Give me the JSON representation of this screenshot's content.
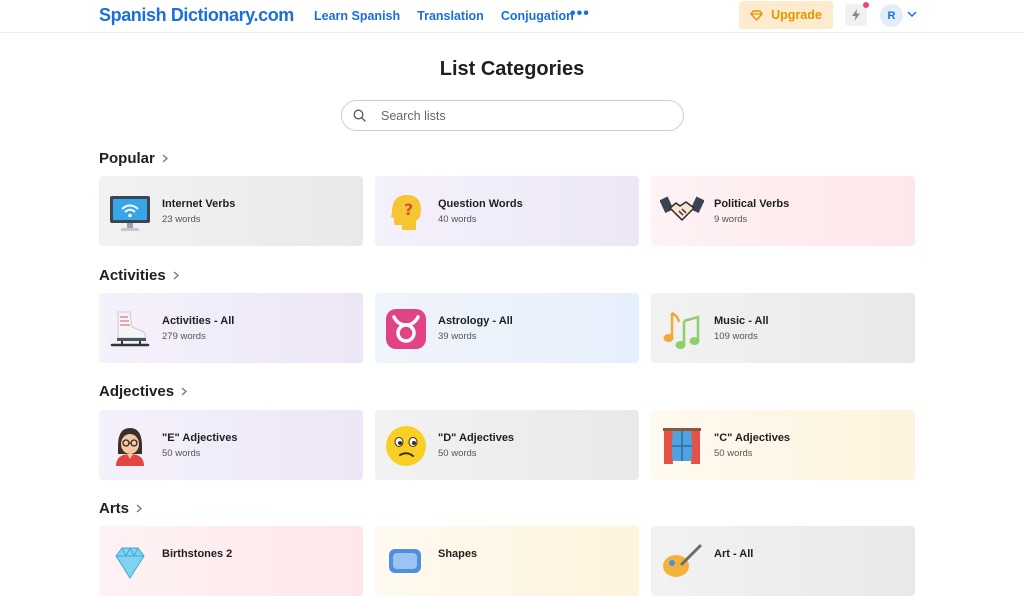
{
  "header": {
    "logo": "Spanish Dictionary.com",
    "nav": [
      "Learn Spanish",
      "Translation",
      "Conjugation"
    ],
    "more": "•••",
    "upgrade": "Upgrade",
    "avatar_initial": "R"
  },
  "page": {
    "title": "List Categories",
    "search_placeholder": "Search lists"
  },
  "sections": [
    {
      "title": "Popular",
      "cards": [
        {
          "name": "Internet Verbs",
          "count": "23 words",
          "icon": "computer-wifi-icon"
        },
        {
          "name": "Question Words",
          "count": "40 words",
          "icon": "question-head-icon"
        },
        {
          "name": "Political Verbs",
          "count": "9 words",
          "icon": "handshake-icon"
        }
      ]
    },
    {
      "title": "Activities",
      "cards": [
        {
          "name": "Activities - All",
          "count": "279 words",
          "icon": "ice-skate-icon"
        },
        {
          "name": "Astrology - All",
          "count": "39 words",
          "icon": "taurus-icon"
        },
        {
          "name": "Music - All",
          "count": "109 words",
          "icon": "music-notes-icon"
        }
      ]
    },
    {
      "title": "Adjectives",
      "cards": [
        {
          "name": "\"E\" Adjectives",
          "count": "50 words",
          "icon": "woman-glasses-icon"
        },
        {
          "name": "\"D\" Adjectives",
          "count": "50 words",
          "icon": "confused-face-icon"
        },
        {
          "name": "\"C\" Adjectives",
          "count": "50 words",
          "icon": "curtains-icon"
        }
      ]
    },
    {
      "title": "Arts",
      "cards": [
        {
          "name": "Birthstones 2",
          "count": "",
          "icon": "diamond-icon"
        },
        {
          "name": "Shapes",
          "count": "",
          "icon": "shapes-icon"
        },
        {
          "name": "Art - All",
          "count": "",
          "icon": "paintbrush-icon"
        }
      ]
    }
  ],
  "colors": {
    "brand_blue": "#1a6fdc",
    "upgrade_bg": "#fdebcd",
    "upgrade_text": "#e69400"
  }
}
